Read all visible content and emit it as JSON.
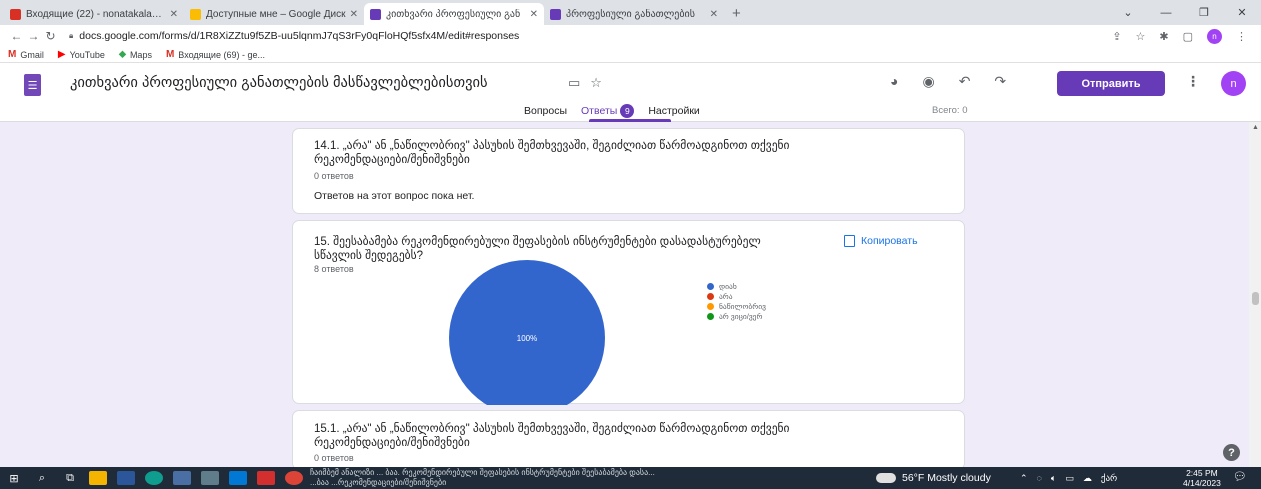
{
  "browser": {
    "tabs": [
      {
        "title": "Входящие (22) - nonatakalandze",
        "favicon_color": "#d93025",
        "active": false
      },
      {
        "title": "Доступные мне – Google Диск",
        "favicon_color": "#fbbc04",
        "active": false
      },
      {
        "title": "კითხვარი პროფესიული გან",
        "favicon_color": "#673ab7",
        "active": true
      },
      {
        "title": "პროფესიული განათლების",
        "favicon_color": "#673ab7",
        "active": false
      }
    ],
    "new_tab_label": "+",
    "url": "docs.google.com/forms/d/1R8XiZZtu9f5ZB-uu5lqnmJ7qS3rFy0qFloHQf5sfx4M/edit#responses",
    "bookmarks": [
      {
        "label": "Gmail",
        "icon": "gmail-icon",
        "color": "#d93025"
      },
      {
        "label": "YouTube",
        "icon": "youtube-icon",
        "color": "#ff0000"
      },
      {
        "label": "Maps",
        "icon": "maps-icon",
        "color": "#34a853"
      },
      {
        "label": "Входящие (69) - ge...",
        "icon": "gmail-icon",
        "color": "#d93025"
      }
    ]
  },
  "form": {
    "title": "კითხვარი პროფესიული განათლების მასწავლებლებისთვის",
    "send_label": "Отправить",
    "avatar_letter": "n",
    "tabs": {
      "questions": "Вопросы",
      "responses": "Ответы",
      "responses_count": "9",
      "settings": "Настройки"
    },
    "total_label": "Всего: 0"
  },
  "cards": [
    {
      "question": "14.1. „არა\" ან „ნაწილობრივ\" პასუხის შემთხვევაში, შეგიძლიათ წარმოადგინოთ თქვენი რეკომენდაციები/შენიშვნები",
      "count": "0 ответов",
      "empty_message": "Ответов на этот вопрос пока нет."
    },
    {
      "question": "15. შეესაბამება რეკომენდირებული შეფასების ინსტრუმენტები დასადასტურებელ სწავლის შედეგებს?",
      "count": "8 ответов",
      "copy_label": "Копировать"
    },
    {
      "question": "15.1. „არა\" ან „ნაწილობრივ\" პასუხის შემთხვევაში, შეგიძლიათ წარმოადგინოთ თქვენი რეკომენდაციები/შენიშვნები",
      "count": "0 ответов"
    }
  ],
  "chart_data": {
    "type": "pie",
    "categories": [
      "დიახ",
      "არა",
      "ნაწილობრივ",
      "არ ვიცი/ვერ"
    ],
    "values": [
      100,
      0,
      0,
      0
    ],
    "colors": [
      "#3366cc",
      "#dc3912",
      "#ff9900",
      "#109618"
    ],
    "data_labels": [
      "100%"
    ],
    "legend": "right"
  },
  "taskbar": {
    "popup_line1": "ჩაიმბემ ანალიზი ... ბაა. რეკომენდირებული შეფასების ინსტრუმენტები შეესაბამება დასა...",
    "popup_line2": "...ბაა ...რეკომენდაციები/შენიშვნები",
    "weather": "56°F  Mostly cloudy",
    "lang": "ქარ",
    "time": "2:45 PM",
    "date": "4/14/2023"
  }
}
